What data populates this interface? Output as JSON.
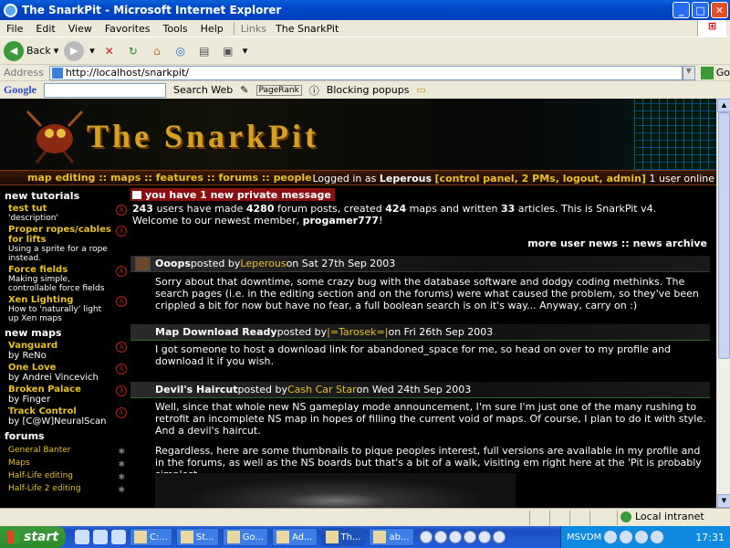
{
  "window": {
    "title": "The SnarkPit - Microsoft Internet Explorer"
  },
  "menu": [
    "File",
    "Edit",
    "View",
    "Favorites",
    "Tools",
    "Help"
  ],
  "links_label": "Links",
  "links_item": "The SnarkPit",
  "toolbar": {
    "back": "Back"
  },
  "address": {
    "label": "Address",
    "url": "http://localhost/snarkpit/",
    "go": "Go"
  },
  "google": {
    "logo": "Google",
    "search": "Search Web",
    "pagerank": "PageRank",
    "popups": "Blocking popups"
  },
  "site": {
    "logo": "The SnarkPit",
    "nav": [
      "map editing",
      "maps",
      "features",
      "forums",
      "people"
    ],
    "nav_sep": "::",
    "login_prefix": "Logged in as ",
    "user": "Leperous",
    "user_links": "[control panel, 2 PMs, logout, admin]",
    "online": " 1 user online",
    "pm": "you have 1 new private message",
    "stats": {
      "users": "243",
      "mid1": " users have made ",
      "posts": "4280",
      "mid2": " forum posts, created ",
      "maps": "424",
      "mid3": " maps and written ",
      "articles": "33",
      "mid4": " articles. This is SnarkPit v4."
    },
    "welcome_prefix": "Welcome to our newest member, ",
    "newest": "progamer777",
    "welcome_suffix": "!",
    "more_news": "more user news",
    "news_archive": "news archive"
  },
  "sidebar": {
    "tutorials_h": "new tutorials",
    "tutorials": [
      {
        "t": "test tut",
        "d": "'description'"
      },
      {
        "t": "Proper ropes/cables for lifts",
        "d": "Using a sprite for a rope instead."
      },
      {
        "t": "Force fields",
        "d": "Making simple, controllable force fields"
      },
      {
        "t": "Xen Lighting",
        "d": "How to 'naturally' light up Xen maps"
      }
    ],
    "maps_h": "new maps",
    "maps": [
      {
        "t": "Vanguard",
        "d": "by ReNo"
      },
      {
        "t": "One Love",
        "d": "by Andrei Vincevich"
      },
      {
        "t": "Broken Palace",
        "d": "by Finger"
      },
      {
        "t": "Track Control",
        "d": "by [C@W]NeuralScan"
      }
    ],
    "forums_h": "forums",
    "forums": [
      "General Banter",
      "Maps",
      "Half-Life editing",
      "Half-Life 2 editing"
    ]
  },
  "posts": [
    {
      "title": "Ooops",
      "by": " posted by ",
      "author": "Leperous",
      "date": " on Sat 27th Sep 2003",
      "body": "Sorry about that downtime, some crazy bug with the database software and dodgy coding methinks. The search pages (i.e. in the editing section and on the forums) were what caused the problem, so they've been crippled a bit for now but have no fear, a full boolean search is on it's way... Anyway, carry on :)"
    },
    {
      "title": "Map Download Ready",
      "by": " posted by ",
      "author": "|=Tarosek=|",
      "date": " on Fri 26th Sep 2003",
      "body": "I got someone to host a download link for abandoned_space for me, so head on over to my profile and download it if you wish."
    },
    {
      "title": "Devil's Haircut",
      "by": " posted by ",
      "author": "Cash Car Star",
      "date": " on Wed 24th Sep 2003",
      "body": "Well, since that whole new NS gameplay mode announcement, I'm sure I'm just one of the many rushing to retrofit an incomplete NS map in hopes of filling the current void of maps. Of course, I plan to do it with style. And a devil's haircut.",
      "body2": "Regardless, here are some thumbnails to pique peoples interest, full versions are available in my profile and in the forums, as well as the NS boards but that's a bit of a walk, visiting em right here at the 'Pit is probably simplest."
    }
  ],
  "status": {
    "zone": "Local intranet"
  },
  "taskbar": {
    "start": "start",
    "tasks": [
      "C:...",
      "St...",
      "Go...",
      "Ad...",
      "Th...",
      "ab..."
    ],
    "tray_label": "MSVDM",
    "clock": "17:31"
  }
}
